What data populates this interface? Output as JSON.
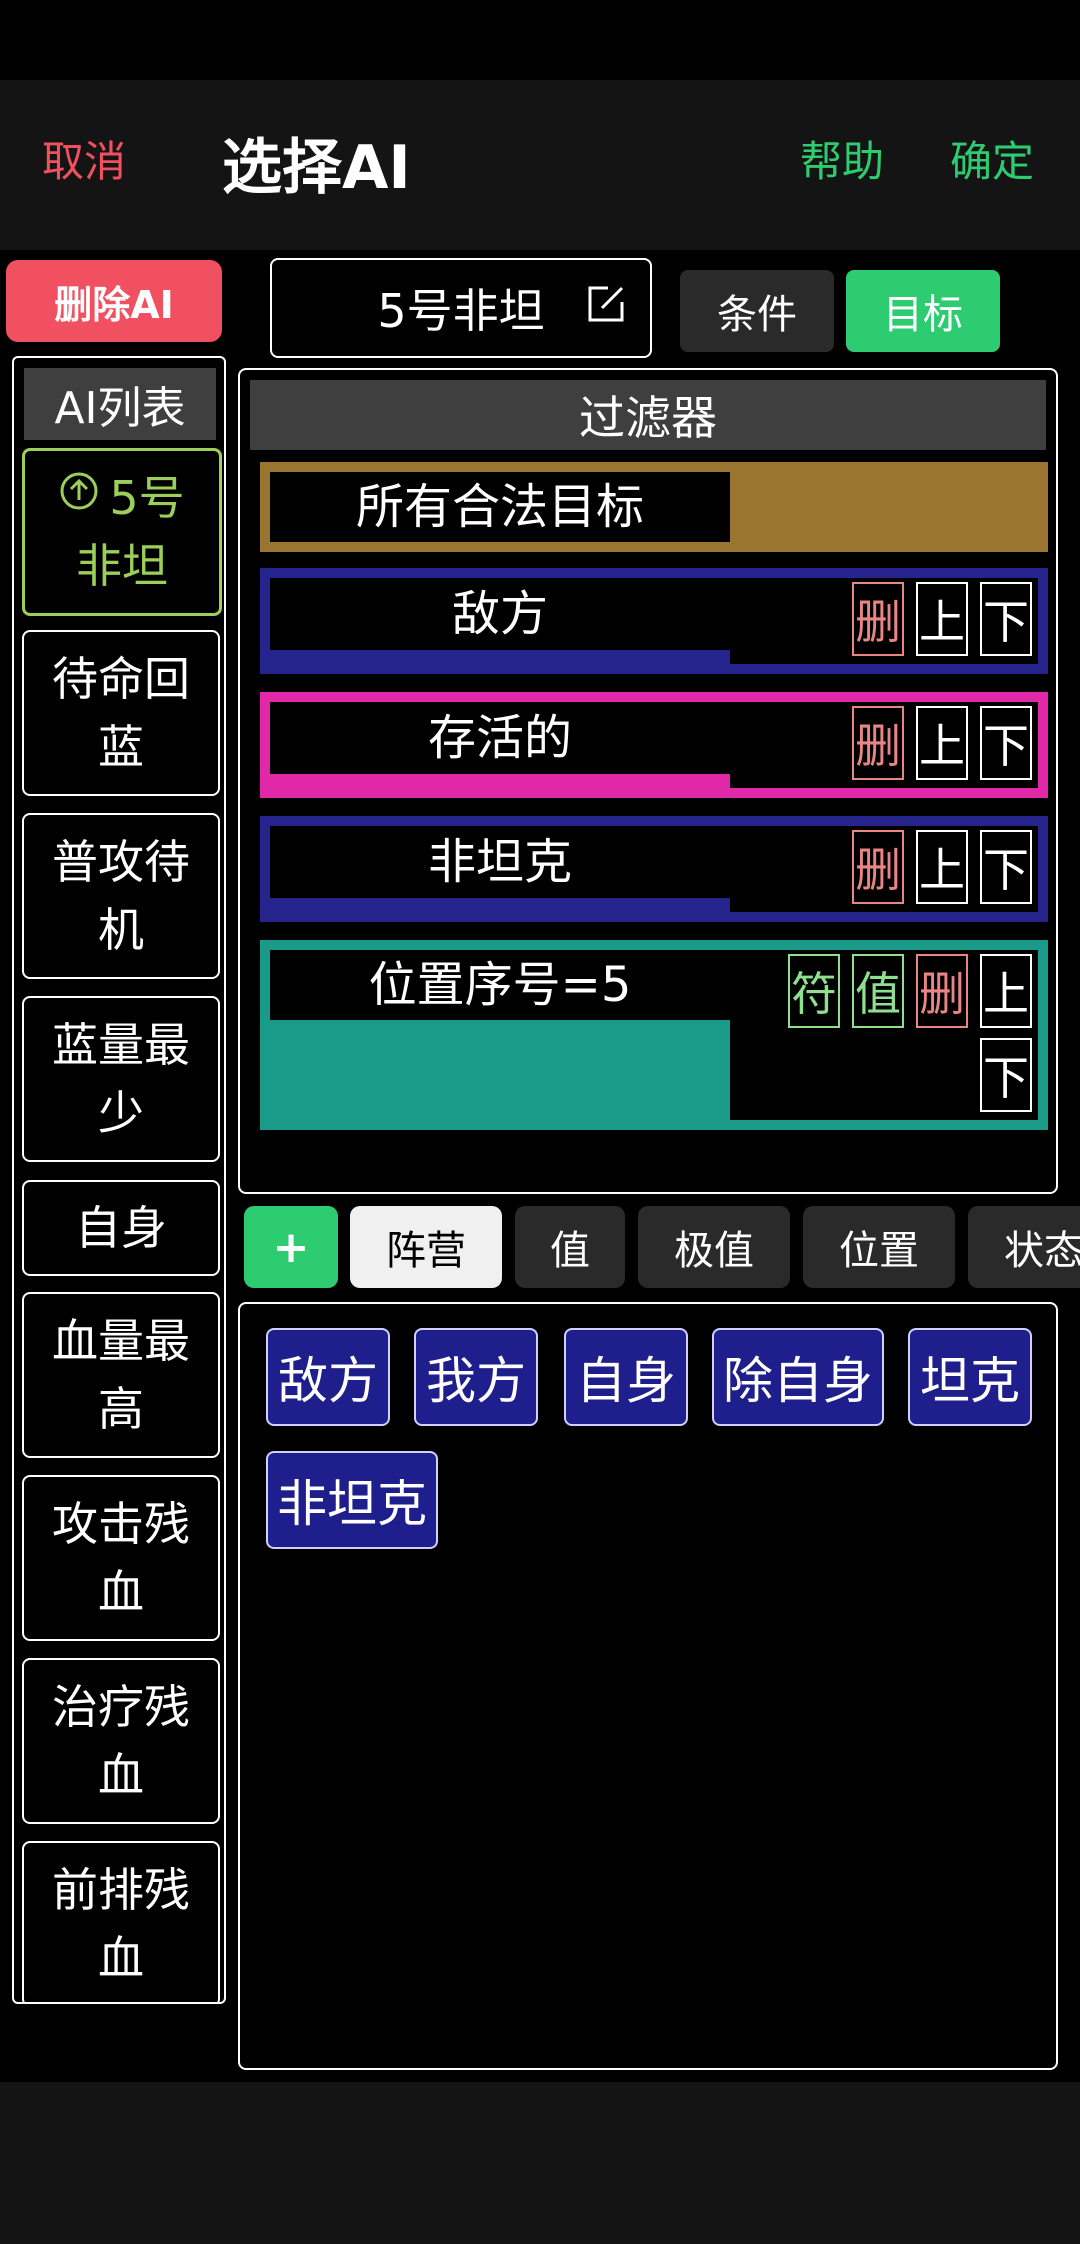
{
  "header": {
    "cancel": "取消",
    "title": "选择AI",
    "help": "帮助",
    "confirm": "确定"
  },
  "delete_ai": "删除AI",
  "ai_list": {
    "header": "AI列表",
    "items": [
      {
        "line1": "5号",
        "line2": "非坦",
        "active": true
      },
      {
        "line1": "待命回",
        "line2": "蓝"
      },
      {
        "line1": "普攻待",
        "line2": "机"
      },
      {
        "line1": "蓝量最",
        "line2": "少"
      },
      {
        "line1": "自身",
        "line2": ""
      },
      {
        "line1": "血量最",
        "line2": "高"
      },
      {
        "line1": "攻击残",
        "line2": "血"
      },
      {
        "line1": "治疗残",
        "line2": "血"
      },
      {
        "line1": "前排残",
        "line2": "血"
      }
    ]
  },
  "ai_name": "5号非坦",
  "mode_tabs": {
    "condition": "条件",
    "target": "目标"
  },
  "filter": {
    "title": "过滤器",
    "rows": [
      {
        "label": "所有合法目标",
        "color": "#9a7530"
      },
      {
        "label": "敌方",
        "color": "#24248c"
      },
      {
        "label": "存活的",
        "color": "#e028a8"
      },
      {
        "label": "非坦克",
        "color": "#24248c"
      },
      {
        "label": "位置序号=5",
        "color": "#1a9a88"
      }
    ],
    "btn_del": "删",
    "btn_up": "上",
    "btn_down": "下",
    "btn_symbol": "符",
    "btn_value": "值"
  },
  "category_tabs": {
    "add": "+",
    "camp": "阵营",
    "value": "值",
    "extreme": "极值",
    "position": "位置",
    "status": "状态"
  },
  "options": [
    "敌方",
    "我方",
    "自身",
    "除自身",
    "坦克",
    "非坦克"
  ],
  "colors": {
    "accent_green": "#2ecc71",
    "cancel_red": "#f0505f",
    "active_item": "#9ccf5a"
  }
}
